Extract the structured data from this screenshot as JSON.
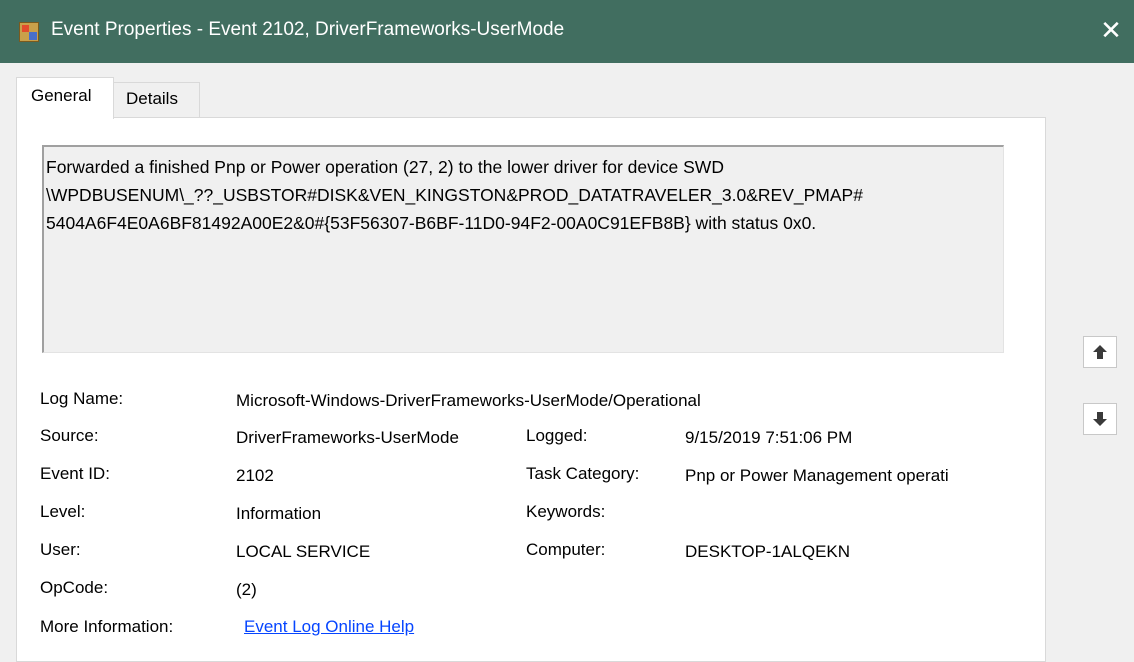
{
  "window": {
    "title": "Event Properties - Event 2102, DriverFrameworks-UserMode",
    "close_glyph": "✕"
  },
  "tabs": [
    {
      "label": "General",
      "active": true
    },
    {
      "label": "Details",
      "active": false
    }
  ],
  "description": "Forwarded a finished Pnp or Power operation (27, 2) to the lower driver for device SWD\n\\WPDBUSENUM\\_??_USBSTOR#DISK&VEN_KINGSTON&PROD_DATATRAVELER_3.0&REV_PMAP#\n5404A6F4E0A6BF81492A00E2&0#{53F56307-B6BF-11D0-94F2-00A0C91EFB8B} with status 0x0.",
  "fields": {
    "log_name": {
      "label": "Log Name:",
      "value": "Microsoft-Windows-DriverFrameworks-UserMode/Operational"
    },
    "source": {
      "label": "Source:",
      "value": "DriverFrameworks-UserMode"
    },
    "logged": {
      "label": "Logged:",
      "value": "9/15/2019 7:51:06 PM"
    },
    "event_id": {
      "label": "Event ID:",
      "value": "2102"
    },
    "task_category": {
      "label": "Task Category:",
      "value": "Pnp or Power Management operati"
    },
    "level": {
      "label": "Level:",
      "value": "Information"
    },
    "keywords": {
      "label": "Keywords:",
      "value": ""
    },
    "user": {
      "label": "User:",
      "value": "LOCAL SERVICE"
    },
    "computer": {
      "label": "Computer:",
      "value": "DESKTOP-1ALQEKN"
    },
    "opcode": {
      "label": "OpCode:",
      "value": "(2)"
    },
    "more_info": {
      "label": "More Information:",
      "link": "Event Log Online Help"
    }
  },
  "nav": {
    "up_icon": "arrow-up-icon",
    "down_icon": "arrow-down-icon"
  },
  "colors": {
    "titlebar": "#416e60",
    "link": "#0645ff"
  }
}
